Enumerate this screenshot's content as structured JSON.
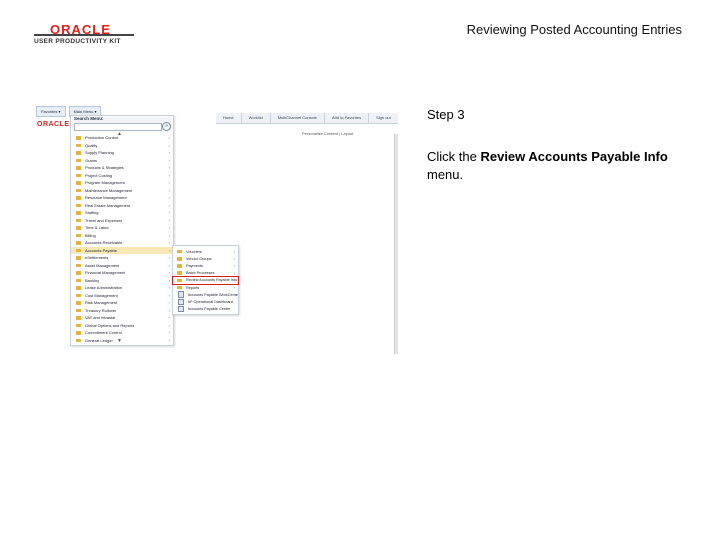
{
  "header": {
    "brand": "ORACLE",
    "tagline": "USER PRODUCTIVITY KIT",
    "title": "Reviewing Posted Accounting Entries"
  },
  "step": {
    "label": "Step 3",
    "instruction_prefix": "Click the ",
    "instruction_bold": "Review Accounts Payable Info",
    "instruction_suffix": " menu."
  },
  "screenshot": {
    "tabs": [
      "Favorites ▾",
      "Main Menu ▾"
    ],
    "topbar": [
      "Home",
      "Worklist",
      "MultiChannel Console",
      "Add to Favorites",
      "Sign out"
    ],
    "brand": "ORACLE",
    "personalize": "Personalize Content | Layout",
    "search_label": "Search Menu:",
    "main_menu": [
      "Production Control",
      "Quality",
      "Supply Planning",
      "Grants",
      "Products & Strategies",
      "Project Costing",
      "Program Management",
      "Maintenance Management",
      "Resource Management",
      "Real Estate Management",
      "Staffing",
      "Travel and Expenses",
      "Time & Labor",
      "Billing",
      "Accounts Receivable",
      "Accounts Payable",
      "eSettlements",
      "Asset Management",
      "Financial Management",
      "Banking",
      "Lease Administration",
      "Cost Management",
      "Risk Management",
      "Treasury Rollover",
      "VAT and Intrastat",
      "Global Options and Reports",
      "Commitment Control",
      "General Ledger"
    ],
    "highlighted_index": 15,
    "submenu": [
      {
        "label": "Vouchers",
        "type": "folder"
      },
      {
        "label": "Vendor Groups",
        "type": "folder"
      },
      {
        "label": "Payments",
        "type": "folder"
      },
      {
        "label": "Batch Processes",
        "type": "folder"
      },
      {
        "label": "Review Accounts Payable Info",
        "type": "folder",
        "target": true
      },
      {
        "label": "Reports",
        "type": "folder"
      },
      {
        "label": "Accounts Payable WorkCenter",
        "type": "page"
      },
      {
        "label": "AP Operational Dashboard",
        "type": "page"
      },
      {
        "label": "Accounts Payable Center",
        "type": "page"
      }
    ]
  }
}
